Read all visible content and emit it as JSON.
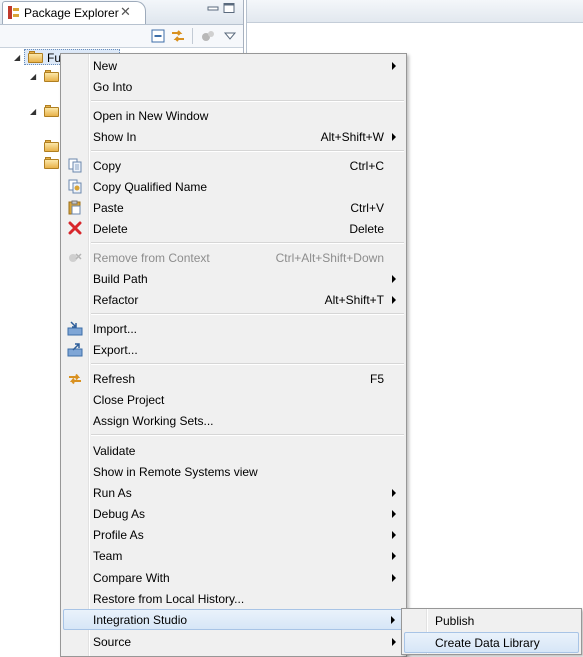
{
  "package_explorer": {
    "title": "Package Explorer",
    "close_glyph": "✕",
    "selected_node_label": "Fu"
  },
  "context_menu": {
    "groups": [
      {
        "items": [
          {
            "label": "New",
            "submenu": true
          },
          {
            "label": "Go Into"
          }
        ]
      },
      {
        "items": [
          {
            "label": "Open in New Window"
          },
          {
            "label": "Show In",
            "shortcut": "Alt+Shift+W",
            "submenu": true
          }
        ]
      },
      {
        "items": [
          {
            "label": "Copy",
            "shortcut": "Ctrl+C",
            "icon": "copy-icon"
          },
          {
            "label": "Copy Qualified Name",
            "icon": "copy-qualified-name-icon"
          },
          {
            "label": "Paste",
            "shortcut": "Ctrl+V",
            "icon": "paste-icon"
          },
          {
            "label": "Delete",
            "shortcut": "Delete",
            "icon": "delete-icon"
          }
        ]
      },
      {
        "items": [
          {
            "label": "Remove from Context",
            "shortcut": "Ctrl+Alt+Shift+Down",
            "icon": "remove-from-context-icon",
            "disabled": true
          },
          {
            "label": "Build Path",
            "submenu": true
          },
          {
            "label": "Refactor",
            "shortcut": "Alt+Shift+T",
            "submenu": true
          }
        ]
      },
      {
        "items": [
          {
            "label": "Import...",
            "icon": "import-icon"
          },
          {
            "label": "Export...",
            "icon": "export-icon"
          }
        ]
      },
      {
        "items": [
          {
            "label": "Refresh",
            "shortcut": "F5",
            "icon": "refresh-icon"
          },
          {
            "label": "Close Project"
          },
          {
            "label": "Assign Working Sets..."
          }
        ]
      },
      {
        "items": [
          {
            "label": "Validate"
          },
          {
            "label": "Show in Remote Systems view"
          },
          {
            "label": "Run As",
            "submenu": true
          },
          {
            "label": "Debug As",
            "submenu": true
          },
          {
            "label": "Profile As",
            "submenu": true
          },
          {
            "label": "Team",
            "submenu": true
          },
          {
            "label": "Compare With",
            "submenu": true
          },
          {
            "label": "Restore from Local History..."
          },
          {
            "label": "Integration Studio",
            "submenu": true,
            "highlighted": true
          },
          {
            "label": "Source",
            "submenu": true
          }
        ]
      }
    ]
  },
  "submenu": {
    "parent": "Integration Studio",
    "items": [
      {
        "label": "Publish"
      },
      {
        "label": "Create Data Library",
        "highlighted": true
      }
    ]
  },
  "colors": {
    "menu_background": "#f0f0f0",
    "highlight": "#d7e6f7",
    "disabled_text": "#8d8d8d",
    "delete_icon": "#d8262b"
  }
}
